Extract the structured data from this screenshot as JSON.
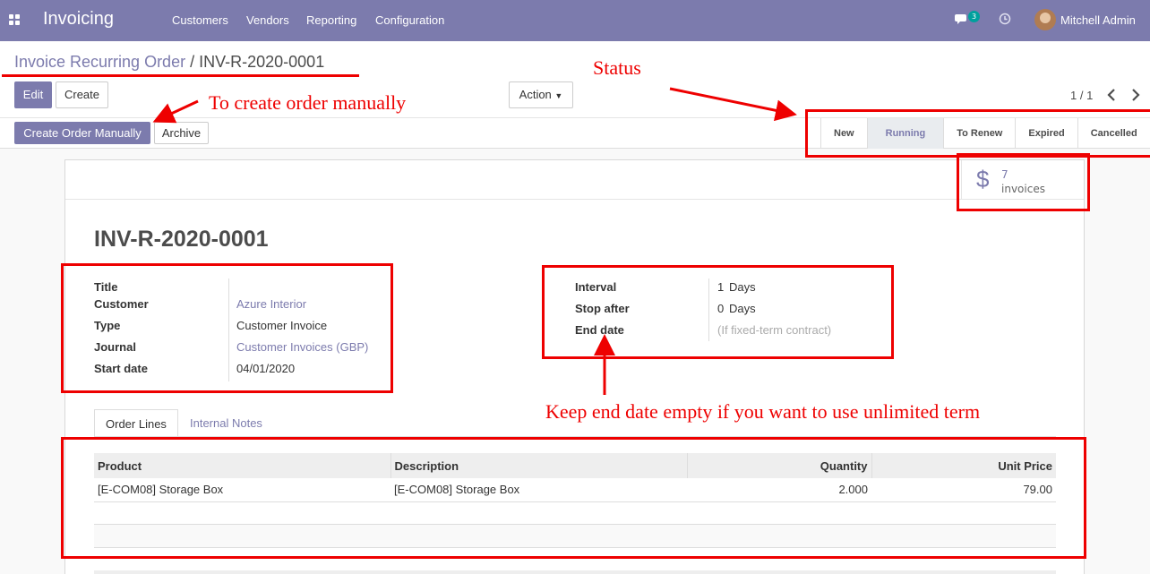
{
  "navbar": {
    "app_name": "Invoicing",
    "menu": [
      "Customers",
      "Vendors",
      "Reporting",
      "Configuration"
    ],
    "chat_count": "3",
    "user_name": "Mitchell Admin"
  },
  "breadcrumb": {
    "parent": "Invoice Recurring Order",
    "separator": "/",
    "current": "INV-R-2020-0001"
  },
  "toolbar": {
    "edit_label": "Edit",
    "create_label": "Create",
    "action_label": "Action",
    "pager": "1 / 1",
    "create_manual_label": "Create Order Manually",
    "archive_label": "Archive"
  },
  "status": {
    "steps": [
      "New",
      "Running",
      "To Renew",
      "Expired",
      "Cancelled"
    ],
    "active": "Running"
  },
  "smart_button": {
    "count": "7",
    "label": "invoices",
    "icon": "dollar-icon"
  },
  "record": {
    "title": "INV-R-2020-0001",
    "left_fields": [
      {
        "label": "Title",
        "value": ""
      },
      {
        "label": "Customer",
        "value": "Azure Interior"
      },
      {
        "label": "Type",
        "value": "Customer Invoice"
      },
      {
        "label": "Journal",
        "value": "Customer Invoices (GBP)"
      },
      {
        "label": "Start date",
        "value": "04/01/2020"
      }
    ],
    "right_fields": [
      {
        "label": "Interval",
        "value": "1",
        "unit": "Days"
      },
      {
        "label": "Stop after",
        "value": "0",
        "unit": "Days"
      },
      {
        "label": "End date",
        "value": "",
        "placeholder": "(If fixed-term contract)"
      }
    ]
  },
  "tabs": [
    "Order Lines",
    "Internal Notes"
  ],
  "order_lines": {
    "columns": [
      "Product",
      "Description",
      "Quantity",
      "Unit Price"
    ],
    "rows": [
      [
        "[E-COM08] Storage Box",
        "[E-COM08] Storage Box",
        "2.000",
        "79.00"
      ]
    ]
  },
  "annotations": {
    "status": "Status",
    "manual": "To create order manually",
    "end_date": "Keep end date empty if you want to use unlimited term"
  },
  "colors": {
    "brand": "#7c7bad",
    "annotation": "#e00000"
  }
}
